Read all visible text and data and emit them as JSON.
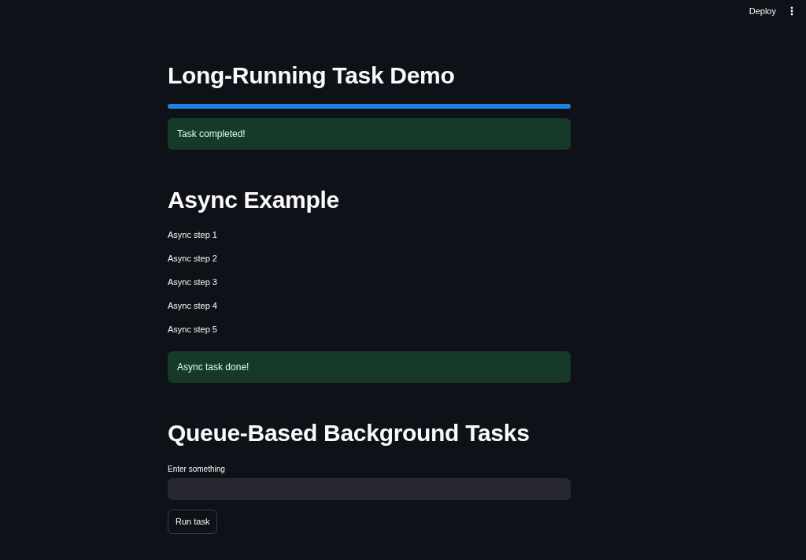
{
  "header": {
    "deploy_label": "Deploy"
  },
  "blocks": [
    {
      "kind": "heading",
      "text": "Long-Running Task Demo"
    },
    {
      "kind": "progress",
      "level": 1
    },
    {
      "kind": "success",
      "text": "Task completed!"
    },
    {
      "kind": "heading",
      "text": "Async Example"
    },
    {
      "kind": "text",
      "text": "Async step 1"
    },
    {
      "kind": "text",
      "text": "Async step 2"
    },
    {
      "kind": "text",
      "text": "Async step 3"
    },
    {
      "kind": "text",
      "text": "Async step 4"
    },
    {
      "kind": "text",
      "text": "Async step 5"
    },
    {
      "kind": "success",
      "text": "Async task done!"
    },
    {
      "kind": "heading",
      "text": "Queue-Based Background Tasks"
    },
    {
      "kind": "text_input",
      "label": "Enter something"
    },
    {
      "kind": "button",
      "text": "Run task"
    }
  ]
}
